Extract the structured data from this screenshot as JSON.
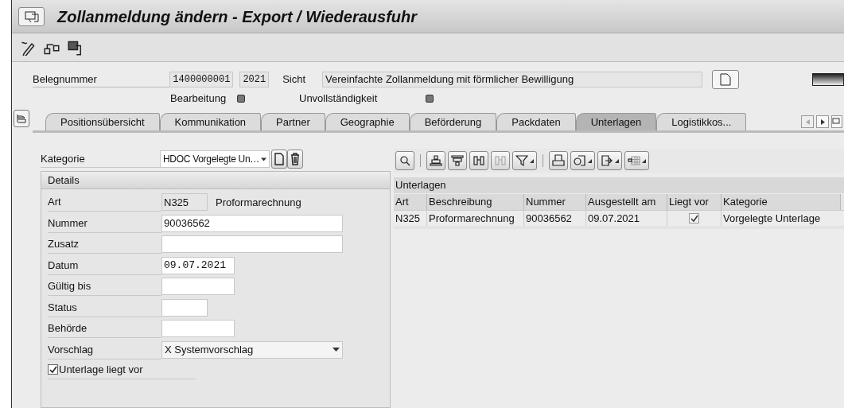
{
  "window": {
    "title": "Zollanmeldung ändern - Export / Wiederausfuhr"
  },
  "header": {
    "belegnummer": {
      "label": "Belegnummer",
      "number": "1400000001",
      "year": "2021"
    },
    "sicht": {
      "label": "Sicht",
      "value": "Vereinfachte Zollanmeldung mit förmlicher Bewilligung"
    },
    "status": [
      {
        "label": "Bearbeitung"
      },
      {
        "label": "Unvollständigkeit"
      }
    ]
  },
  "tabs": [
    {
      "label": "Positionsübersicht",
      "selected": false
    },
    {
      "label": "Kommunikation",
      "selected": false
    },
    {
      "label": "Partner",
      "selected": false
    },
    {
      "label": "Geographie",
      "selected": false
    },
    {
      "label": "Beförderung",
      "selected": false
    },
    {
      "label": "Packdaten",
      "selected": false
    },
    {
      "label": "Unterlagen",
      "selected": true
    },
    {
      "label": "Logistikkos...",
      "selected": false
    }
  ],
  "kategorie": {
    "label": "Kategorie",
    "value": "HDOC Vorgelegte Un…"
  },
  "details": {
    "title": "Details",
    "fields": [
      {
        "label": "Art",
        "kind": "code",
        "value": "N325",
        "description": "Proformarechnung"
      },
      {
        "label": "Nummer",
        "kind": "wide",
        "value": "90036562"
      },
      {
        "label": "Zusatz",
        "kind": "wide"
      },
      {
        "label": "Datum",
        "kind": "date",
        "value": "09.07.2021"
      },
      {
        "label": "Gültig bis",
        "kind": "medium"
      },
      {
        "label": "Status",
        "kind": "small"
      },
      {
        "label": "Behörde",
        "kind": "medium"
      },
      {
        "label": "Vorschlag",
        "kind": "dropdown",
        "value": "X Systemvorschlag"
      }
    ],
    "checkbox": {
      "label": "Unterlage liegt vor",
      "checked": true
    }
  },
  "table": {
    "title": "Unterlagen",
    "columns": [
      "Art",
      "Beschreibung",
      "Nummer",
      "Ausgestellt am",
      "Liegt vor",
      "Kategorie"
    ],
    "rows": [
      {
        "art": "N325",
        "beschreibung": "Proformarechnung",
        "nummer": "90036562",
        "ausgestellt": "09.07.2021",
        "liegt_vor": true,
        "kategorie": "Vorgelegte Unterlage"
      }
    ]
  }
}
